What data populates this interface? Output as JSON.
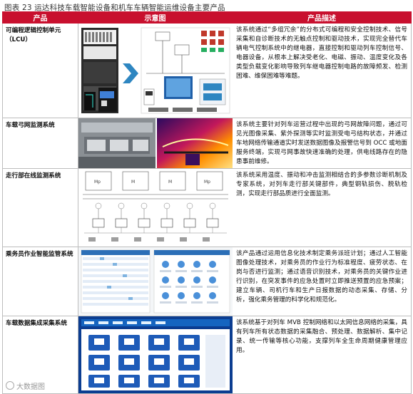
{
  "caption": "图表 23 运达科技车载智能设备和机车车辆智能运维设备主要产品",
  "headers": [
    "产品",
    "示意图",
    "产品描述"
  ],
  "rows": [
    {
      "name": "可编程逻辑控制单元（LCU）",
      "desc": "该系统通过“多组冗余”的分布式可编程和安全控制技术、信号采集和自诊断技术的无触点控制和驱动技术，实现完全替代车辆电气控制系统中的继电器，直接控制和驱动列车控制信号、电器设备，从根本上解决受老化、电磁、振动、温度变化及各类型负载变化影响导致列车继电器控制电路的故障频发、检测困难、维保困难等难题。"
    },
    {
      "name": "车载弓网监测系统",
      "desc": "该系统主要针对列车运营过程中出现的弓网故障问题，通过可见光图像采集、紫外探测等实时监测受电弓结构状态，并通过车地网络传输通道实时发送数据图像及报警信号到 OCC 或地面服务终端，实现弓网事故快速准确的处理，供电线路存在的隐患事前维修。"
    },
    {
      "name": "走行部在线监测系统",
      "desc": "该系统采用温度、振动和冲击监测相结合的多参数诊断机制及专家系统，对列车走行部关键部件，典型钢轨损伤、脱轨检测，实现走行部品质进行全面监测。"
    },
    {
      "name": "乘务员作业智能监管系统",
      "desc": "该产品通过运用信息化技术制定乘务派班计划；通过人工智能图像处理技术，对乘务员的作业行为标准程度、疲劳状态、在岗与否进行监测；通过语音识别技术，对乘务员的关键作业进行识别，在突发事件的应急处置时立即推送预置的应急预案；建立车辆、司机行车和生产日报数据的动态采集、存储、分析，强化乘务管理的科学化和规范化。"
    },
    {
      "name": "车载数据集成采集系统",
      "desc": "该系统基于对列车 MVB 控制网络和以太网信息网络的采集，具有列车所有状态数据的采集融合、预处理、数据解析、集中记录、统一传输等核心功能，支撑列车全生命周期健康管理应用。"
    }
  ],
  "watermark": "大数据图"
}
